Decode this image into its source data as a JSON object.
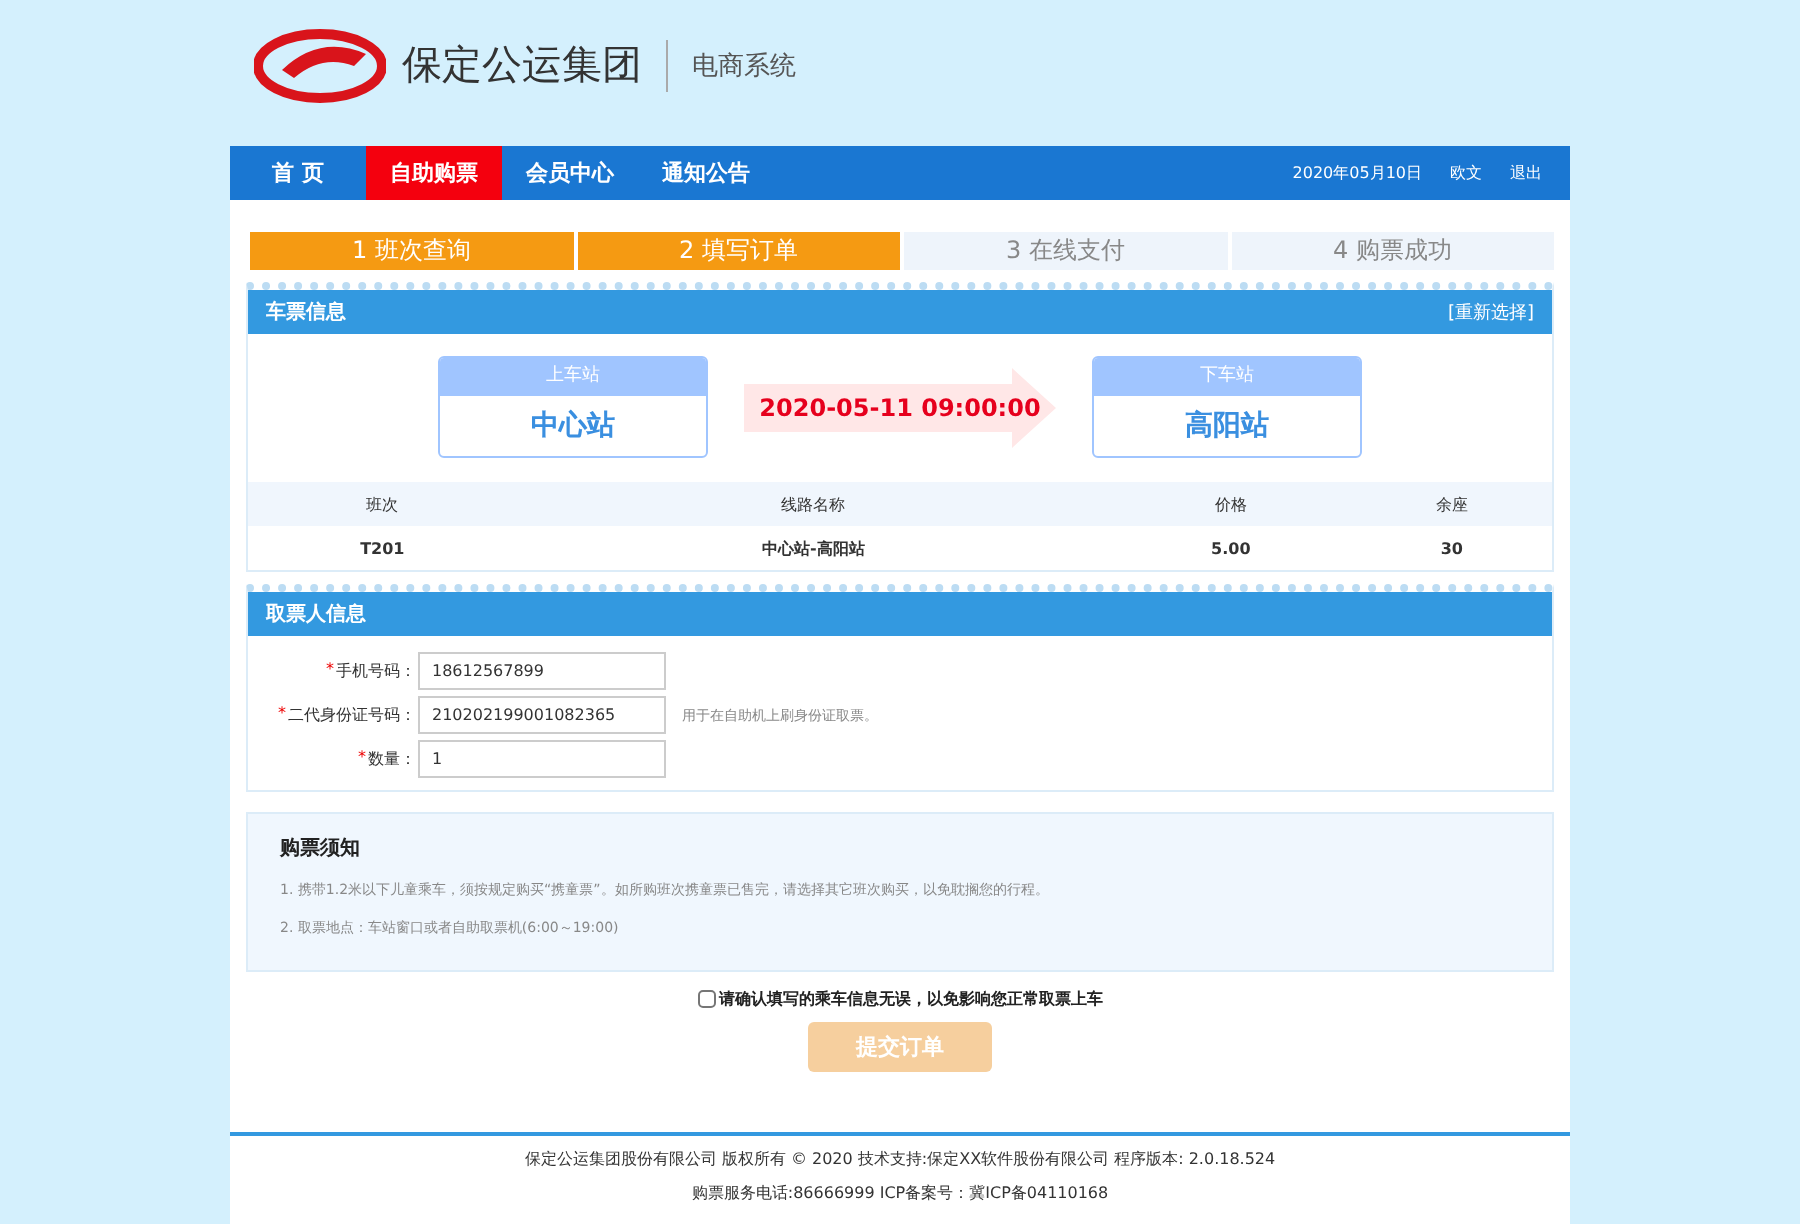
{
  "header": {
    "company": "保定公运集团",
    "system": "电商系统"
  },
  "nav": {
    "items": [
      {
        "label": "首 页",
        "selected": false
      },
      {
        "label": "自助购票",
        "selected": true
      },
      {
        "label": "会员中心",
        "selected": false
      },
      {
        "label": "通知公告",
        "selected": false
      }
    ],
    "date": "2020年05月10日",
    "links": [
      "欧文",
      "退出"
    ]
  },
  "steps": [
    {
      "label": "1 班次查询",
      "done": true
    },
    {
      "label": "2 填写订单",
      "done": true
    },
    {
      "label": "3 在线支付",
      "done": false
    },
    {
      "label": "4 购票成功",
      "done": false
    }
  ],
  "ticket": {
    "title": "车票信息",
    "reselect": "[重新选择]",
    "from": {
      "caption": "上车站",
      "name": "中心站"
    },
    "datetime": "2020-05-11 09:00:00",
    "to": {
      "caption": "下车站",
      "name": "高阳站"
    },
    "columns": [
      "班次",
      "线路名称",
      "价格",
      "余座"
    ],
    "rows": [
      [
        "T201",
        "中心站-高阳站",
        "5.00",
        "30"
      ]
    ]
  },
  "passenger": {
    "title": "取票人信息",
    "fields": [
      {
        "mark": "*",
        "label": "手机号码：",
        "value": "18612567899"
      },
      {
        "mark": "*",
        "label": "二代身份证号码：",
        "value": "210202199001082365",
        "hint": "用于在自助机上刷身份证取票。"
      },
      {
        "mark": "*",
        "label": "数量：",
        "value": "1"
      }
    ]
  },
  "notice": {
    "title": "购票须知",
    "lines": [
      "1. 携带1.2米以下儿童乘车，须按规定购买“携童票”。如所购班次携童票已售完，请选择其它班次购买，以免耽搁您的行程。",
      "2. 取票地点：车站窗口或者自助取票机(6:00～19:00)"
    ]
  },
  "confirm": {
    "label": "请确认填写的乘车信息无误，以免影响您正常取票上车",
    "checked": false
  },
  "submit": {
    "label": "提交订单",
    "disabled": true
  },
  "footer": [
    "保定公运集团股份有限公司 版权所有 © 2020 技术支持:保定XX软件股份有限公司 程序版本: 2.0.18.524",
    "购票服务电话:86666999 ICP备案号：冀ICP备04110168"
  ]
}
